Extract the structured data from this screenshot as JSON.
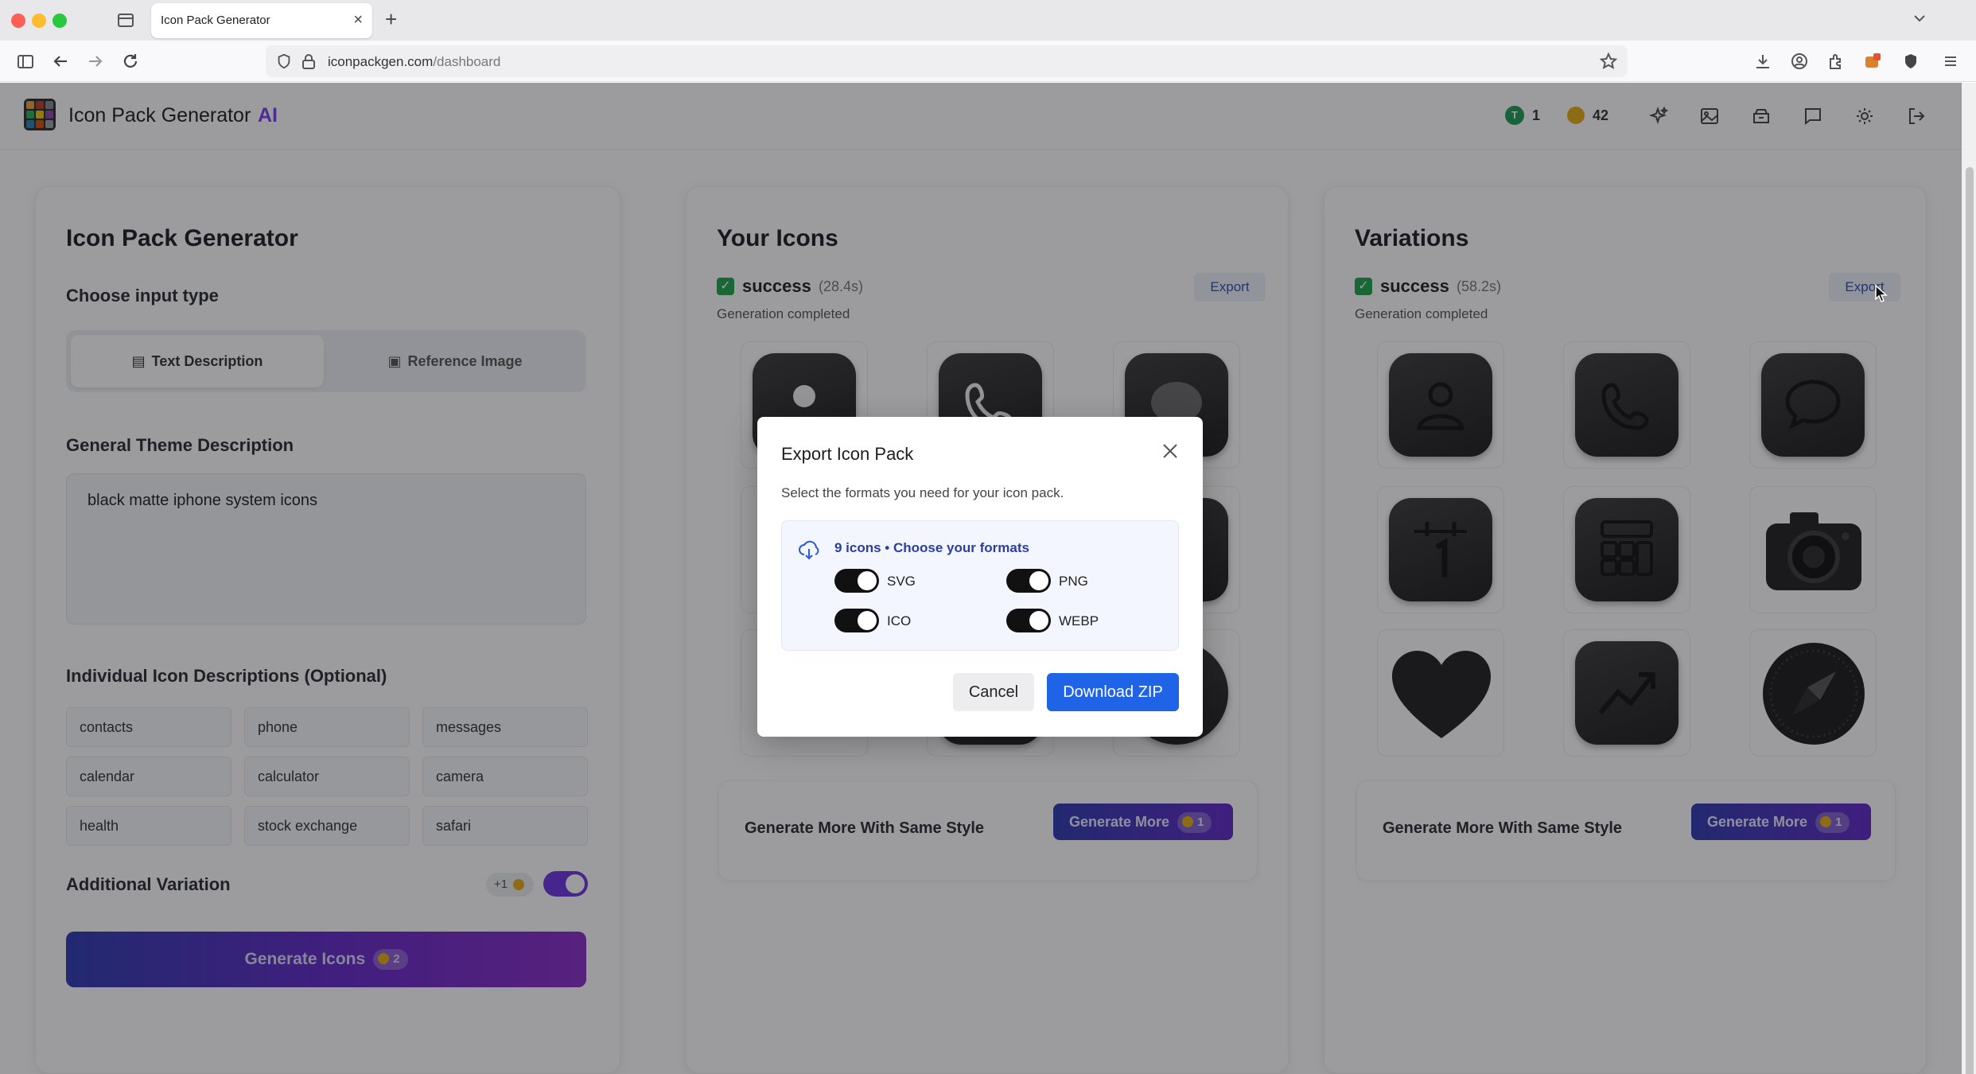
{
  "browser": {
    "tab_title": "Icon Pack Generator",
    "url_host": "iconpackgen.com",
    "url_path": "/dashboard"
  },
  "header": {
    "app_name": "Icon Pack Generator",
    "ai_tag": "AI",
    "badge_letter": "T",
    "badge_count": "1",
    "coin_count": "42",
    "icons": [
      "sparkles-icon",
      "image-icon",
      "archive-icon",
      "chat-icon",
      "gear-icon",
      "logout-icon"
    ]
  },
  "left": {
    "title": "Icon Pack Generator",
    "input_type_label": "Choose input type",
    "tab_text": "Text Description",
    "tab_image": "Reference Image",
    "theme_label": "General Theme Description",
    "theme_value": "black matte iphone system icons",
    "individual_label": "Individual Icon Descriptions (Optional)",
    "chips": [
      "contacts",
      "phone",
      "messages",
      "calendar",
      "calculator",
      "camera",
      "health",
      "stock exchange",
      "safari"
    ],
    "variation_label": "Additional Variation",
    "variation_cost": "+1",
    "generate_label": "Generate Icons",
    "generate_cost": "2"
  },
  "your_icons": {
    "title": "Your Icons",
    "status": "success",
    "time": "(28.4s)",
    "sub": "Generation completed",
    "export_label": "Export",
    "more_title": "Generate More With Same Style",
    "more_btn": "Generate More",
    "more_cost": "1"
  },
  "variations": {
    "title": "Variations",
    "status": "success",
    "time": "(58.2s)",
    "sub": "Generation completed",
    "export_label": "Export",
    "icons": [
      "contact-icon",
      "phone-icon",
      "message-icon",
      "calendar-icon",
      "calculator-icon",
      "camera-icon",
      "heart-icon",
      "stock-icon",
      "compass-icon"
    ],
    "more_title": "Generate More With Same Style",
    "more_btn": "Generate More",
    "more_cost": "1"
  },
  "modal": {
    "title": "Export Icon Pack",
    "desc": "Select the formats you need for your icon pack.",
    "box_head": "9 icons • Choose your formats",
    "formats": [
      {
        "label": "SVG",
        "on": true
      },
      {
        "label": "PNG",
        "on": true
      },
      {
        "label": "ICO",
        "on": true
      },
      {
        "label": "WEBP",
        "on": true
      }
    ],
    "cancel": "Cancel",
    "download": "Download ZIP"
  },
  "colors": {
    "accent": "#6b35e0",
    "primary_blue": "#1f63e6",
    "success": "#1ea44a",
    "coin": "#e4ad14"
  }
}
